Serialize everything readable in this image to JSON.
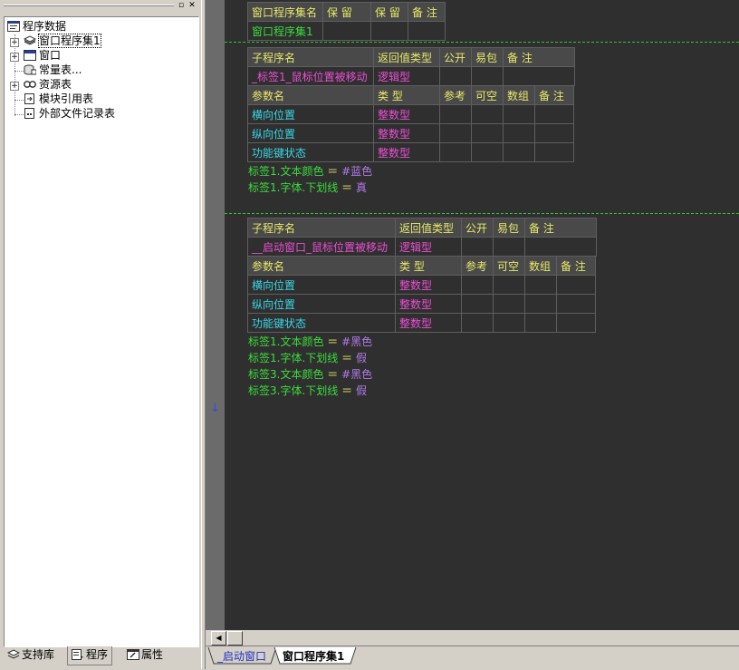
{
  "left_panel": {
    "tree": [
      {
        "label": "程序数据",
        "icon": "program-data-icon"
      },
      {
        "label": "窗口程序集1",
        "icon": "assembly-icon",
        "expandable": true,
        "selected": true
      },
      {
        "label": "窗口",
        "icon": "window-icon",
        "expandable": true
      },
      {
        "label": "常量表...",
        "icon": "constants-icon"
      },
      {
        "label": "资源表",
        "icon": "resources-icon",
        "expandable": true
      },
      {
        "label": "模块引用表",
        "icon": "module-ref-icon"
      },
      {
        "label": "外部文件记录表",
        "icon": "external-file-icon"
      }
    ],
    "tabs": [
      {
        "label": "支持库",
        "icon": "library-icon"
      },
      {
        "label": "程序",
        "icon": "program-icon",
        "active": true
      },
      {
        "label": "属性",
        "icon": "properties-icon"
      }
    ]
  },
  "code": {
    "assembly_table": {
      "headers": [
        "窗口程序集名",
        "保 留",
        "保 留",
        "备 注"
      ],
      "row": [
        "窗口程序集1",
        "",
        "",
        ""
      ]
    },
    "sub1": {
      "headers": [
        "子程序名",
        "返回值类型",
        "公开",
        "易包",
        "备 注"
      ],
      "row": [
        "_标签1_鼠标位置被移动",
        "逻辑型",
        "",
        "",
        ""
      ],
      "param_headers": [
        "参数名",
        "类 型",
        "参考",
        "可空",
        "数组",
        "备 注"
      ],
      "params": [
        [
          "横向位置",
          "整数型"
        ],
        [
          "纵向位置",
          "整数型"
        ],
        [
          "功能键状态",
          "整数型"
        ]
      ],
      "statements": [
        {
          "target": "标签1.文本颜色",
          "op": "＝",
          "value": "#蓝色"
        },
        {
          "target": "标签1.字体.下划线",
          "op": "＝",
          "value": "真"
        }
      ]
    },
    "sub2": {
      "headers": [
        "子程序名",
        "返回值类型",
        "公开",
        "易包",
        "备 注"
      ],
      "row": [
        "__启动窗口_鼠标位置被移动",
        "逻辑型",
        "",
        "",
        ""
      ],
      "param_headers": [
        "参数名",
        "类 型",
        "参考",
        "可空",
        "数组",
        "备 注"
      ],
      "params": [
        [
          "横向位置",
          "整数型"
        ],
        [
          "纵向位置",
          "整数型"
        ],
        [
          "功能键状态",
          "整数型"
        ]
      ],
      "statements": [
        {
          "target": "标签1.文本颜色",
          "op": "＝",
          "value": "#黑色"
        },
        {
          "target": "标签1.字体.下划线",
          "op": "＝",
          "value": "假"
        },
        {
          "target": "标签3.文本颜色",
          "op": "＝",
          "value": "#黑色"
        },
        {
          "target": "标签3.字体.下划线",
          "op": "＝",
          "value": "假"
        }
      ]
    }
  },
  "bottom_tabs": [
    {
      "label": "_启动窗口",
      "active": false
    },
    {
      "label": "窗口程序集1",
      "active": true
    }
  ],
  "colors": {
    "code_bg": "#2f2f2f",
    "header_text": "#e8e86a",
    "name_pink": "#ec4dd6",
    "param_cyan": "#39d6e6",
    "assembly_green": "#3bdc3b",
    "value_purple": "#b07ae8",
    "separator_green": "#31c431"
  }
}
